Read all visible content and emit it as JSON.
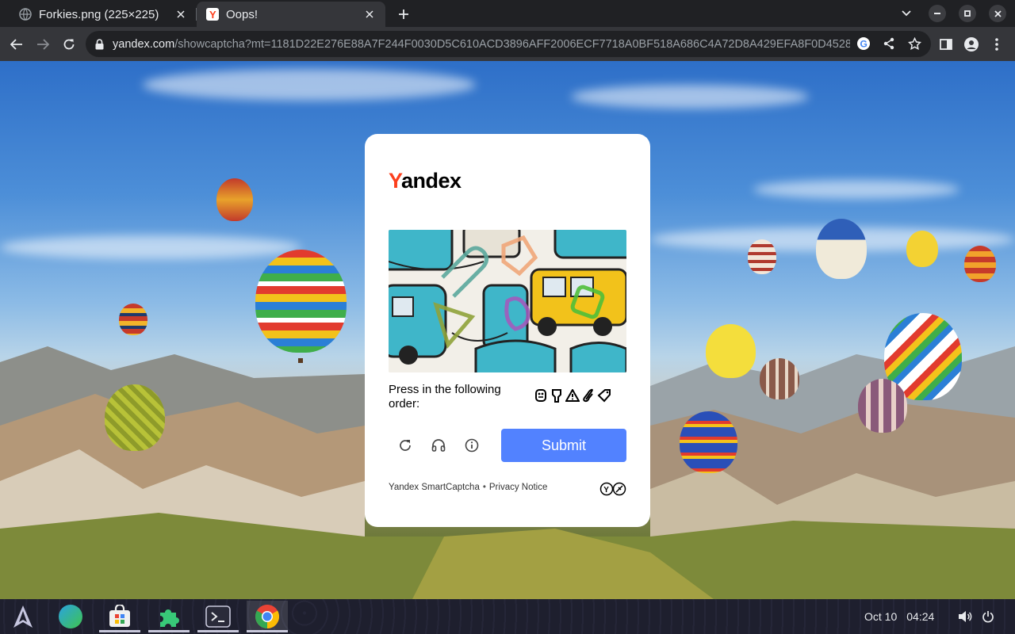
{
  "tabs": [
    {
      "title": "Forkies.png (225×225)",
      "active": false,
      "favicon": "globe-icon"
    },
    {
      "title": "Oops!",
      "active": true,
      "favicon": "yandex-favicon-icon"
    }
  ],
  "toolbar": {
    "url_host": "yandex.com",
    "url_path": "/showcaptcha?mt=1181D22E276E88A7F244F0030D5C610ACD3896AFF2006ECF7718A0BF518A686C4A72D8A429EFA8F0D45288E33..."
  },
  "captcha": {
    "logo_first": "Y",
    "logo_rest": "andex",
    "instruction": "Press in the following order:",
    "order_icons": [
      "robot-icon",
      "key-icon",
      "warning-icon",
      "paperclip-icon",
      "tag-icon"
    ],
    "submit_label": "Submit",
    "footer_brand": "Yandex SmartCaptcha",
    "footer_sep": "•",
    "footer_privacy": "Privacy Notice"
  },
  "taskbar": {
    "date": "Oct 10",
    "time": "04:24",
    "apps": [
      "launcher-icon",
      "web-browser-icon",
      "store-icon",
      "extensions-icon",
      "terminal-icon",
      "chrome-icon"
    ]
  },
  "colors": {
    "yandex_red": "#fc3f1d",
    "submit_blue": "#5282ff",
    "tab_active": "#35363a",
    "tab_strip": "#202124"
  }
}
